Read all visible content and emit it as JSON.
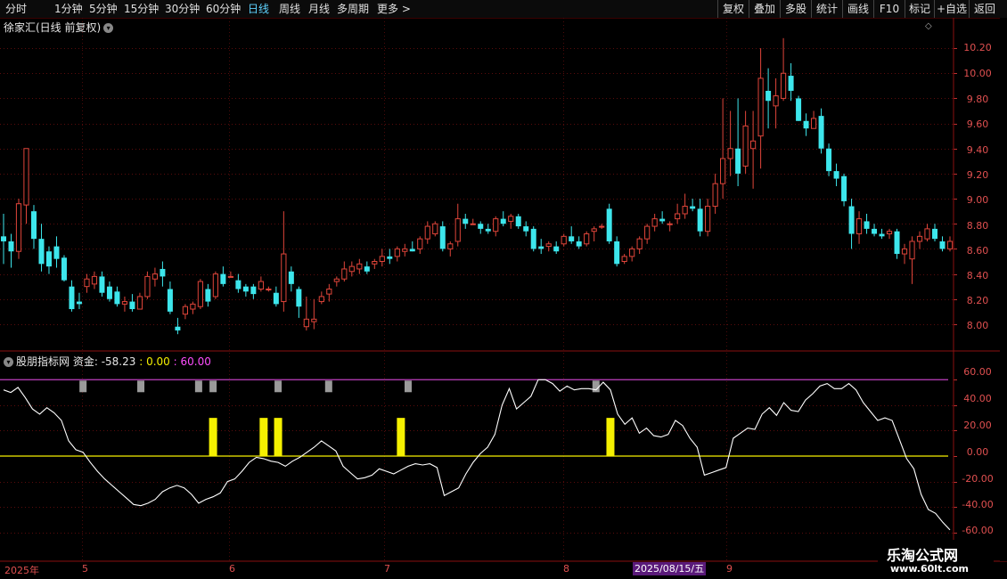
{
  "toolbar": {
    "periods": [
      "分时",
      "1分钟",
      "5分钟",
      "15分钟",
      "30分钟",
      "60分钟",
      "日线",
      "周线",
      "月线",
      "多周期",
      "更多"
    ],
    "active_period": "日线",
    "more_arrow": ">",
    "right_buttons": [
      "复权",
      "叠加",
      "多股",
      "统计",
      "画线",
      "F10",
      "标记",
      "+自选",
      "返回"
    ]
  },
  "stock": {
    "title": "徐家汇(日线 前复权)",
    "dropdown_icon": "chevron-down-icon"
  },
  "indicator": {
    "name": "股朋指标网",
    "value_text": "资金: -58.23",
    "value2_text": ": 0.00",
    "value3_text": ": 60.00"
  },
  "price_axis": [
    "10.20",
    "10.00",
    "9.80",
    "9.60",
    "9.40",
    "9.20",
    "9.00",
    "8.80",
    "8.60",
    "8.40",
    "8.20",
    "8.00"
  ],
  "ind_axis": [
    "60.00",
    "40.00",
    "20.00",
    "0.00",
    "-20.00",
    "-40.00",
    "-60.00"
  ],
  "time_axis": [
    "2025年",
    "5",
    "6",
    "7",
    "8",
    "9"
  ],
  "cursor_date": "2025/08/15/五",
  "logo": {
    "line1": "乐淘公式网",
    "line2": "www.60lt.com"
  },
  "colors": {
    "up": "#e0453a",
    "down": "#3de6ec",
    "signal": "#f5f000",
    "level": "#c040c0",
    "line": "#ffffff"
  },
  "chart_data": [
    {
      "type": "candlestick",
      "title": "徐家汇(日线 前复权)",
      "ylim": [
        7.9,
        10.3
      ],
      "candles": [
        [
          8.7,
          8.88,
          8.48,
          8.66
        ],
        [
          8.66,
          8.72,
          8.45,
          8.58
        ],
        [
          8.58,
          9.0,
          8.52,
          8.96
        ],
        [
          8.95,
          9.35,
          8.8,
          9.4
        ],
        [
          8.9,
          8.95,
          8.6,
          8.68
        ],
        [
          8.68,
          8.8,
          8.42,
          8.48
        ],
        [
          8.58,
          8.62,
          8.4,
          8.46
        ],
        [
          8.62,
          8.7,
          8.45,
          8.52
        ],
        [
          8.53,
          8.55,
          8.34,
          8.35
        ],
        [
          8.3,
          8.35,
          8.1,
          8.12
        ],
        [
          8.18,
          8.25,
          8.12,
          8.16
        ],
        [
          8.3,
          8.4,
          8.25,
          8.36
        ],
        [
          8.32,
          8.42,
          8.28,
          8.38
        ],
        [
          8.38,
          8.42,
          8.22,
          8.25
        ],
        [
          8.3,
          8.34,
          8.18,
          8.2
        ],
        [
          8.26,
          8.3,
          8.14,
          8.16
        ],
        [
          8.16,
          8.22,
          8.1,
          8.18
        ],
        [
          8.18,
          8.24,
          8.1,
          8.12
        ],
        [
          8.12,
          8.25,
          8.12,
          8.22
        ],
        [
          8.22,
          8.42,
          8.2,
          8.38
        ],
        [
          8.36,
          8.45,
          8.3,
          8.4
        ],
        [
          8.44,
          8.5,
          8.3,
          8.38
        ],
        [
          8.28,
          8.34,
          8.08,
          8.1
        ],
        [
          7.98,
          8.05,
          7.92,
          7.95
        ],
        [
          8.08,
          8.16,
          8.04,
          8.14
        ],
        [
          8.12,
          8.18,
          8.08,
          8.16
        ],
        [
          8.14,
          8.36,
          8.12,
          8.34
        ],
        [
          8.28,
          8.32,
          8.14,
          8.18
        ],
        [
          8.22,
          8.42,
          8.2,
          8.4
        ],
        [
          8.4,
          8.46,
          8.3,
          8.32
        ],
        [
          8.38,
          8.42,
          8.38,
          8.38
        ],
        [
          8.35,
          8.4,
          8.25,
          8.28
        ],
        [
          8.3,
          8.32,
          8.22,
          8.26
        ],
        [
          8.3,
          8.32,
          8.2,
          8.24
        ],
        [
          8.28,
          8.38,
          8.26,
          8.34
        ],
        [
          8.28,
          8.3,
          8.26,
          8.28
        ],
        [
          8.25,
          8.3,
          8.14,
          8.16
        ],
        [
          8.18,
          8.9,
          8.1,
          8.56
        ],
        [
          8.42,
          8.46,
          8.26,
          8.32
        ],
        [
          8.28,
          8.3,
          8.05,
          8.14
        ],
        [
          7.98,
          8.22,
          7.95,
          8.04
        ],
        [
          8.02,
          8.2,
          7.96,
          8.04
        ],
        [
          8.18,
          8.26,
          8.16,
          8.22
        ],
        [
          8.24,
          8.32,
          8.18,
          8.28
        ],
        [
          8.34,
          8.38,
          8.3,
          8.36
        ],
        [
          8.36,
          8.5,
          8.34,
          8.44
        ],
        [
          8.42,
          8.5,
          8.38,
          8.46
        ],
        [
          8.44,
          8.52,
          8.4,
          8.48
        ],
        [
          8.46,
          8.5,
          8.4,
          8.42
        ],
        [
          8.48,
          8.52,
          8.44,
          8.5
        ],
        [
          8.5,
          8.6,
          8.46,
          8.54
        ],
        [
          8.54,
          8.6,
          8.48,
          8.52
        ],
        [
          8.54,
          8.62,
          8.5,
          8.6
        ],
        [
          8.58,
          8.64,
          8.54,
          8.6
        ],
        [
          8.6,
          8.66,
          8.58,
          8.58
        ],
        [
          8.6,
          8.7,
          8.56,
          8.68
        ],
        [
          8.68,
          8.82,
          8.64,
          8.78
        ],
        [
          8.72,
          8.82,
          8.7,
          8.8
        ],
        [
          8.78,
          8.82,
          8.58,
          8.6
        ],
        [
          8.6,
          8.66,
          8.54,
          8.64
        ],
        [
          8.66,
          8.96,
          8.62,
          8.84
        ],
        [
          8.84,
          8.88,
          8.76,
          8.8
        ],
        [
          8.8,
          8.84,
          8.8,
          8.8
        ],
        [
          8.8,
          8.82,
          8.72,
          8.76
        ],
        [
          8.76,
          8.8,
          8.72,
          8.74
        ],
        [
          8.74,
          8.86,
          8.7,
          8.84
        ],
        [
          8.84,
          8.9,
          8.78,
          8.8
        ],
        [
          8.82,
          8.88,
          8.76,
          8.86
        ],
        [
          8.86,
          8.88,
          8.76,
          8.78
        ],
        [
          8.78,
          8.82,
          8.7,
          8.74
        ],
        [
          8.76,
          8.78,
          8.58,
          8.6
        ],
        [
          8.62,
          8.68,
          8.56,
          8.6
        ],
        [
          8.62,
          8.66,
          8.58,
          8.64
        ],
        [
          8.62,
          8.66,
          8.56,
          8.58
        ],
        [
          8.64,
          8.72,
          8.62,
          8.7
        ],
        [
          8.7,
          8.78,
          8.64,
          8.66
        ],
        [
          8.66,
          8.7,
          8.6,
          8.62
        ],
        [
          8.64,
          8.74,
          8.62,
          8.72
        ],
        [
          8.74,
          8.78,
          8.66,
          8.76
        ],
        [
          8.78,
          8.8,
          8.76,
          8.78
        ],
        [
          8.92,
          8.96,
          8.64,
          8.66
        ],
        [
          8.66,
          8.7,
          8.46,
          8.48
        ],
        [
          8.5,
          8.56,
          8.48,
          8.54
        ],
        [
          8.54,
          8.62,
          8.5,
          8.6
        ],
        [
          8.6,
          8.7,
          8.56,
          8.68
        ],
        [
          8.68,
          8.8,
          8.64,
          8.78
        ],
        [
          8.78,
          8.88,
          8.74,
          8.84
        ],
        [
          8.84,
          8.9,
          8.8,
          8.82
        ],
        [
          8.8,
          8.82,
          8.74,
          8.8
        ],
        [
          8.84,
          8.96,
          8.8,
          8.88
        ],
        [
          8.88,
          9.04,
          8.84,
          8.94
        ],
        [
          8.94,
          9.0,
          8.9,
          8.92
        ],
        [
          8.92,
          9.0,
          8.7,
          8.74
        ],
        [
          8.74,
          9.0,
          8.7,
          8.94
        ],
        [
          8.94,
          9.2,
          8.88,
          9.12
        ],
        [
          9.12,
          9.8,
          9.0,
          9.32
        ],
        [
          9.32,
          9.7,
          9.18,
          9.4
        ],
        [
          9.4,
          9.8,
          9.1,
          9.2
        ],
        [
          9.26,
          9.7,
          9.2,
          9.58
        ],
        [
          9.4,
          9.7,
          9.08,
          9.46
        ],
        [
          9.5,
          10.2,
          9.24,
          9.96
        ],
        [
          9.86,
          10.04,
          9.56,
          9.78
        ],
        [
          9.74,
          9.96,
          9.56,
          9.82
        ],
        [
          9.8,
          10.28,
          9.78,
          10.0
        ],
        [
          9.98,
          10.08,
          9.78,
          9.86
        ],
        [
          9.8,
          9.82,
          9.62,
          9.62
        ],
        [
          9.62,
          9.68,
          9.5,
          9.56
        ],
        [
          9.56,
          9.7,
          9.56,
          9.64
        ],
        [
          9.66,
          9.72,
          9.36,
          9.4
        ],
        [
          9.4,
          9.44,
          9.18,
          9.22
        ],
        [
          9.22,
          9.28,
          9.1,
          9.16
        ],
        [
          9.18,
          9.2,
          8.94,
          8.98
        ],
        [
          8.94,
          9.0,
          8.6,
          8.72
        ],
        [
          8.72,
          8.9,
          8.64,
          8.84
        ],
        [
          8.82,
          8.88,
          8.72,
          8.76
        ],
        [
          8.76,
          8.8,
          8.7,
          8.72
        ],
        [
          8.72,
          8.76,
          8.68,
          8.7
        ],
        [
          8.72,
          8.76,
          8.68,
          8.74
        ],
        [
          8.74,
          8.76,
          8.52,
          8.56
        ],
        [
          8.56,
          8.64,
          8.48,
          8.6
        ],
        [
          8.52,
          8.7,
          8.32,
          8.66
        ],
        [
          8.66,
          8.74,
          8.6,
          8.7
        ],
        [
          8.68,
          8.8,
          8.66,
          8.76
        ],
        [
          8.76,
          8.8,
          8.66,
          8.68
        ],
        [
          8.66,
          8.7,
          8.58,
          8.6
        ],
        [
          8.6,
          8.7,
          8.58,
          8.66
        ]
      ]
    },
    {
      "type": "line",
      "title": "股朋指标网",
      "ylim": [
        -70,
        70
      ],
      "series": [
        {
          "name": "资金",
          "values": [
            52,
            50,
            54,
            46,
            37,
            33,
            38,
            34,
            28,
            12,
            5,
            3,
            -5,
            -12,
            -18,
            -23,
            -28,
            -33,
            -38,
            -39,
            -37,
            -34,
            -28,
            -25,
            -23,
            -25,
            -30,
            -37,
            -34,
            -32,
            -29,
            -20,
            -18,
            -12,
            -5,
            -1,
            -2,
            -4,
            -5,
            -8,
            -4,
            -1,
            3,
            7,
            12,
            8,
            4,
            -8,
            -13,
            -18,
            -17,
            -15,
            -10,
            -12,
            -14,
            -11,
            -8,
            -6,
            -7,
            -6,
            -9,
            -31,
            -28,
            -25,
            -14,
            -5,
            2,
            7,
            17,
            40,
            53,
            37,
            42,
            47,
            60,
            60,
            57,
            51,
            55,
            52,
            53,
            53,
            52,
            58,
            52,
            33,
            25,
            30,
            18,
            22,
            16,
            15,
            17,
            28,
            24,
            14,
            7,
            -15,
            -13,
            -11,
            -9,
            14,
            18,
            22,
            21,
            33,
            38,
            32,
            42,
            36,
            35,
            44,
            49,
            55,
            57,
            53,
            53,
            57,
            52,
            42,
            35,
            28,
            30,
            28,
            13,
            -2,
            -10,
            -30,
            -42,
            -45,
            -52,
            -58
          ]
        },
        {
          "name": "level",
          "values": [
            60
          ]
        },
        {
          "name": "zero",
          "values": [
            0
          ]
        }
      ],
      "signals": [
        29,
        36,
        38,
        55,
        84
      ],
      "markers": [
        11,
        19,
        27,
        29,
        38,
        45,
        56,
        82
      ]
    }
  ]
}
